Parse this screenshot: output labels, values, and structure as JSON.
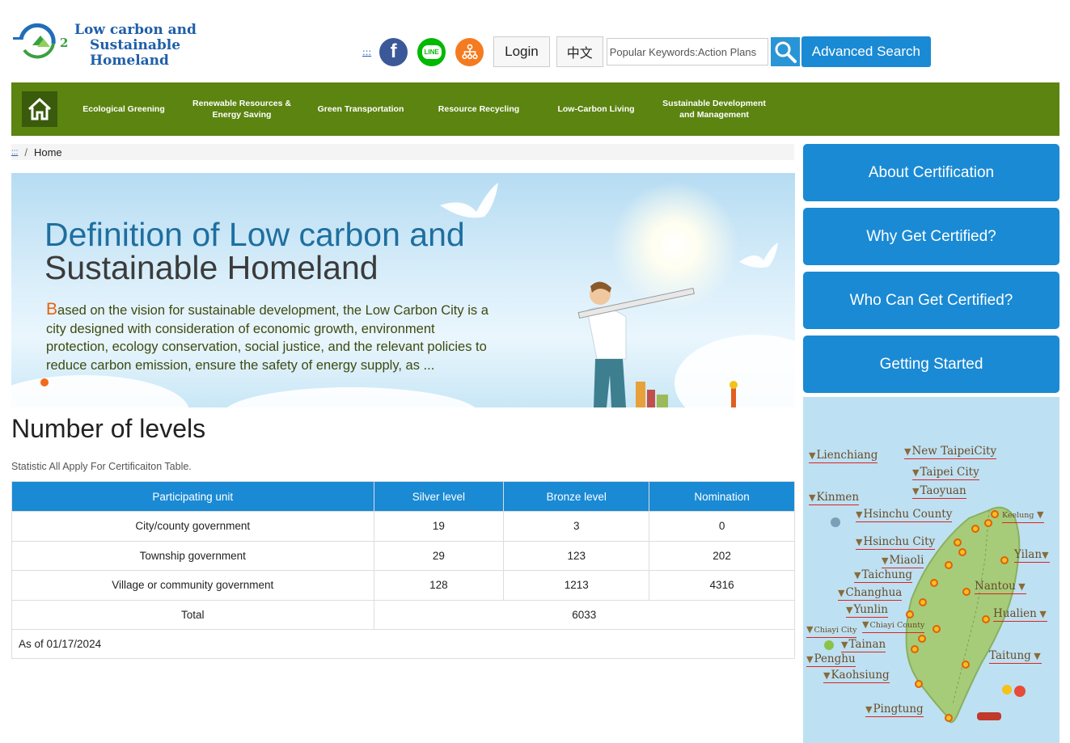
{
  "logo": {
    "line1": "Low carbon and",
    "line2": "Sustainable Homeland",
    "mark": "2"
  },
  "header": {
    "accesskey": ":::",
    "facebook_glyph": "f",
    "line_glyph": "LINE",
    "login_label": "Login",
    "lang_label": "中文",
    "search_placeholder": "Popular Keywords:Action Plans",
    "advanced_search_label": "Advanced Search"
  },
  "nav": {
    "items": [
      {
        "label": "Ecological Greening"
      },
      {
        "label": "Renewable Resources & Energy Saving"
      },
      {
        "label": "Green Transportation"
      },
      {
        "label": "Resource Recycling"
      },
      {
        "label": "Low-Carbon Living"
      },
      {
        "label": "Sustainable Development and Management"
      }
    ]
  },
  "breadcrumb": {
    "accesskey": ":::",
    "separator": "/",
    "home": "Home"
  },
  "banner": {
    "title_line1": "Definition of Low carbon and",
    "title_line2": "Sustainable Homeland",
    "body_initial": "B",
    "body_rest": "ased on the vision for sustainable development, the Low Carbon City is a city designed with consideration of economic growth, environment protection, ecology conservation, social justice, and the relevant policies to reduce carbon emission, ensure the safety of energy supply, as ..."
  },
  "levels": {
    "title": "Number of levels",
    "subtitle": "Statistic All Apply For Certificaiton Table.",
    "headers": [
      "Participating unit",
      "Silver level",
      "Bronze level",
      "Nomination"
    ],
    "rows": [
      [
        "City/county government",
        "19",
        "3",
        "0"
      ],
      [
        "Township government",
        "29",
        "123",
        "202"
      ],
      [
        "Village or community government",
        "128",
        "1213",
        "4316"
      ]
    ],
    "total_label": "Total",
    "total_value": "6033",
    "as_of": "As of 01/17/2024"
  },
  "sidebar": {
    "buttons": [
      "About Certification",
      "Why Get Certified?",
      "Who Can Get Certified?",
      "Getting Started"
    ]
  },
  "map": {
    "labels": [
      "Lienchiang",
      "New TaipeiCity",
      "Taipei City",
      "Taoyuan",
      "Kinmen",
      "Hsinchu County",
      "Keelung",
      "Hsinchu City",
      "Yilan",
      "Miaoli",
      "Taichung",
      "Nantou",
      "Changhua",
      "Yunlin",
      "Hualien",
      "Chiayi City",
      "Chiayi County",
      "Tainan",
      "Penghu",
      "Taitung",
      "Kaohsiung",
      "Pingtung"
    ]
  },
  "colors": {
    "nav_green": "#5b8410",
    "accent_blue": "#1a8ad4",
    "banner_orange": "#e8630c"
  }
}
